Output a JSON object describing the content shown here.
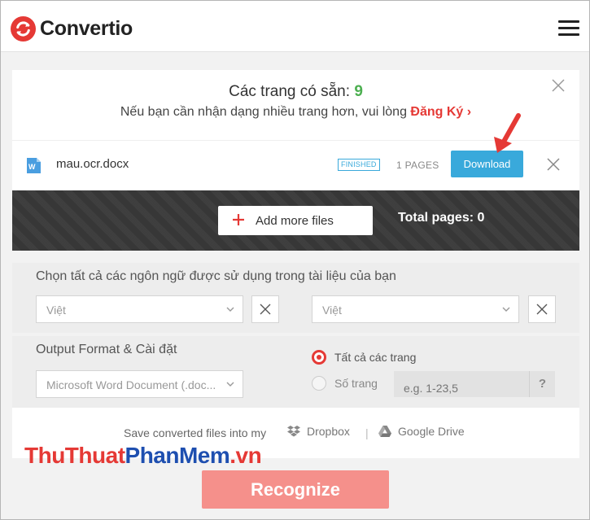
{
  "header": {
    "logo_text": "Convertio",
    "brand_color": "#e53935"
  },
  "notice": {
    "title_prefix": "Các trang có sẵn: ",
    "available_count": "9",
    "subtitle_prefix": "Nếu bạn cần nhận dạng nhiều trang hơn, vui lòng ",
    "signup_link": "Đăng Ký",
    "link_chevron": "›"
  },
  "file": {
    "name": "mau.ocr.docx",
    "status": "FINISHED",
    "pages": "1 PAGES",
    "download_label": "Download"
  },
  "toolbar": {
    "add_files_label": "Add more files",
    "total_pages": "Total pages: 0"
  },
  "language": {
    "label": "Chọn tất cả các ngôn ngữ được sử dụng trong tài liệu của bạn",
    "select1": "Việt",
    "select2": "Việt"
  },
  "output": {
    "label": "Output Format & Cài đặt",
    "format": "Microsoft Word Document (.doc...",
    "option_all": "Tất cả các trang",
    "option_pages": "Số trang",
    "pages_placeholder": "e.g. 1-23,5",
    "help": "?"
  },
  "save": {
    "label": "Save converted files into my",
    "dropbox": "Dropbox",
    "separator": "|",
    "gdrive": "Google Drive"
  },
  "watermark": {
    "part_a": "ThuThuat",
    "part_b": "PhanMem",
    "part_c": ".vn"
  },
  "action": {
    "recognize_label": "Recognize"
  },
  "colors": {
    "accent_blue": "#39a9db",
    "success_green": "#4caf50",
    "recognize_bg": "#f5908b",
    "dark_bar": "#3a3a3a"
  }
}
